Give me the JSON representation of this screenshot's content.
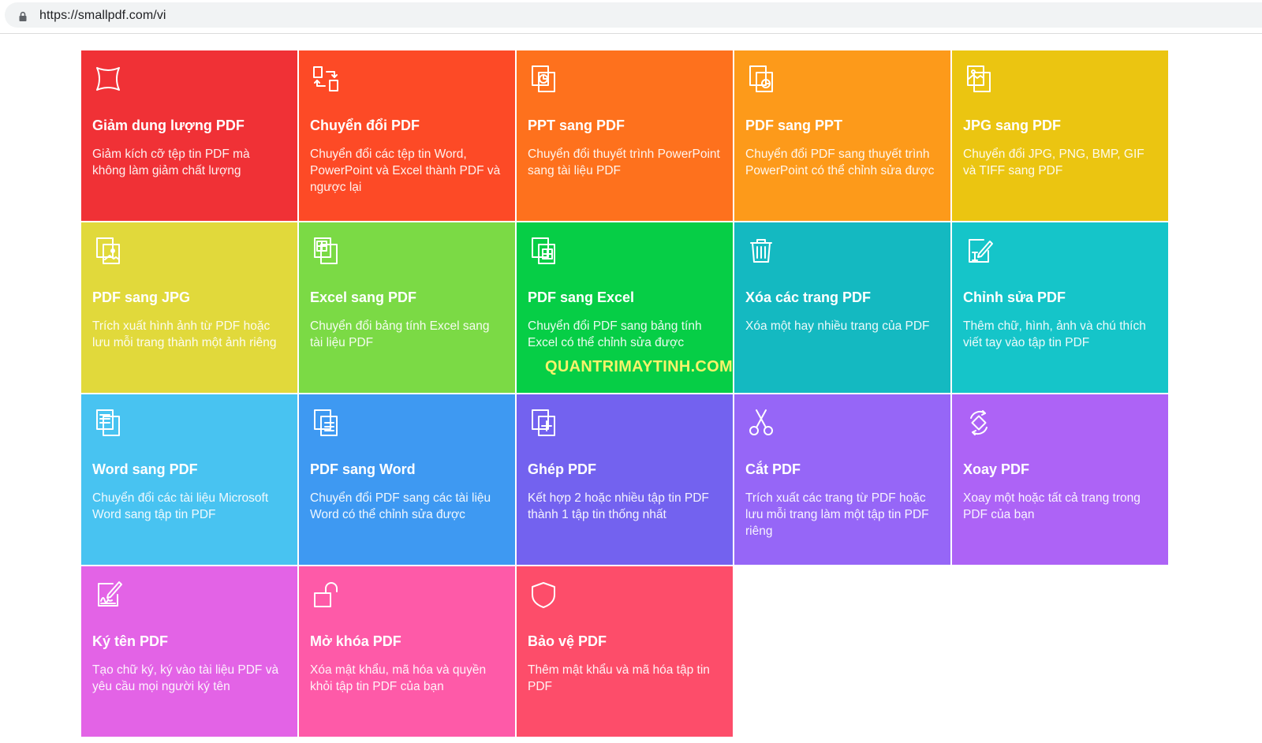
{
  "browser": {
    "url": "https://smallpdf.com/vi"
  },
  "tools": [
    {
      "id": "compress",
      "icon": "compress-icon",
      "title": "Giảm dung lượng PDF",
      "desc": "Giảm kích cỡ tệp tin PDF mà không làm giảm chất lượng",
      "color": "#f03136"
    },
    {
      "id": "convert",
      "icon": "convert-arrows-icon",
      "title": "Chuyển đổi PDF",
      "desc": "Chuyển đổi các tệp tin Word, PowerPoint và Excel thành PDF và ngược lại",
      "color": "#fd4a26"
    },
    {
      "id": "ppt-to-pdf",
      "icon": "ppt-document-icon",
      "title": "PPT sang PDF",
      "desc": "Chuyển đổi thuyết trình PowerPoint sang tài liệu PDF",
      "color": "#fe711d"
    },
    {
      "id": "pdf-to-ppt",
      "icon": "pdf-to-ppt-icon",
      "title": "PDF sang PPT",
      "desc": "Chuyển đổi PDF sang thuyết trình PowerPoint có thể chỉnh sửa được",
      "color": "#fd9a1a"
    },
    {
      "id": "jpg-to-pdf",
      "icon": "image-document-icon",
      "title": "JPG sang PDF",
      "desc": "Chuyển đổi JPG, PNG, BMP, GIF và TIFF sang PDF",
      "color": "#ebc511"
    },
    {
      "id": "pdf-to-jpg",
      "icon": "pdf-to-image-icon",
      "title": "PDF sang JPG",
      "desc": "Trích xuất hình ảnh từ PDF hoặc lưu mỗi trang thành một ảnh riêng",
      "color": "#e1d93b"
    },
    {
      "id": "excel-to-pdf",
      "icon": "spreadsheet-document-icon",
      "title": "Excel sang PDF",
      "desc": "Chuyển đổi bảng tính Excel sang tài liệu PDF",
      "color": "#7bda45"
    },
    {
      "id": "pdf-to-excel",
      "icon": "pdf-to-spreadsheet-icon",
      "title": "PDF sang Excel",
      "desc": "Chuyển đổi PDF sang bảng tính Excel có thể chỉnh sửa được",
      "color": "#06ce46",
      "watermark": "QUANTRIMAYTINH.COM"
    },
    {
      "id": "delete-pages",
      "icon": "trash-icon",
      "title": "Xóa các trang PDF",
      "desc": "Xóa một hay nhiều trang của PDF",
      "color": "#14b9c1"
    },
    {
      "id": "edit-pdf",
      "icon": "edit-document-icon",
      "title": "Chỉnh sửa PDF",
      "desc": "Thêm chữ, hình, ảnh và chú thích viết tay vào tập tin PDF",
      "color": "#15c5c9"
    },
    {
      "id": "word-to-pdf",
      "icon": "word-document-icon",
      "title": "Word sang PDF",
      "desc": "Chuyển đổi các tài liệu Microsoft Word sang tập tin PDF",
      "color": "#48c3f1"
    },
    {
      "id": "pdf-to-word",
      "icon": "pdf-to-word-icon",
      "title": "PDF sang Word",
      "desc": "Chuyển đổi PDF sang các tài liệu Word có thể chỉnh sửa được",
      "color": "#3e99f2"
    },
    {
      "id": "merge",
      "icon": "merge-plus-icon",
      "title": "Ghép PDF",
      "desc": "Kết hợp 2 hoặc nhiều tập tin PDF thành 1 tập tin thống nhất",
      "color": "#7362ef"
    },
    {
      "id": "split",
      "icon": "scissors-icon",
      "title": "Cắt PDF",
      "desc": "Trích xuất các trang từ PDF hoặc lưu mỗi trang làm một tập tin PDF riêng",
      "color": "#9666f7"
    },
    {
      "id": "rotate",
      "icon": "rotate-icon",
      "title": "Xoay PDF",
      "desc": "Xoay một hoặc tất cả trang trong PDF của bạn",
      "color": "#ad63f6"
    },
    {
      "id": "sign",
      "icon": "signature-icon",
      "title": "Ký tên PDF",
      "desc": "Tạo chữ ký, ký vào tài liệu PDF và yêu cầu mọi người ký tên",
      "color": "#e363e6"
    },
    {
      "id": "unlock",
      "icon": "unlock-icon",
      "title": "Mở khóa PDF",
      "desc": "Xóa mật khẩu, mã hóa và quyền khỏi tập tin PDF của bạn",
      "color": "#fe5aa8"
    },
    {
      "id": "protect",
      "icon": "shield-icon",
      "title": "Bảo vệ PDF",
      "desc": "Thêm mật khẩu và mã hóa tập tin PDF",
      "color": "#fd4d6a"
    }
  ]
}
